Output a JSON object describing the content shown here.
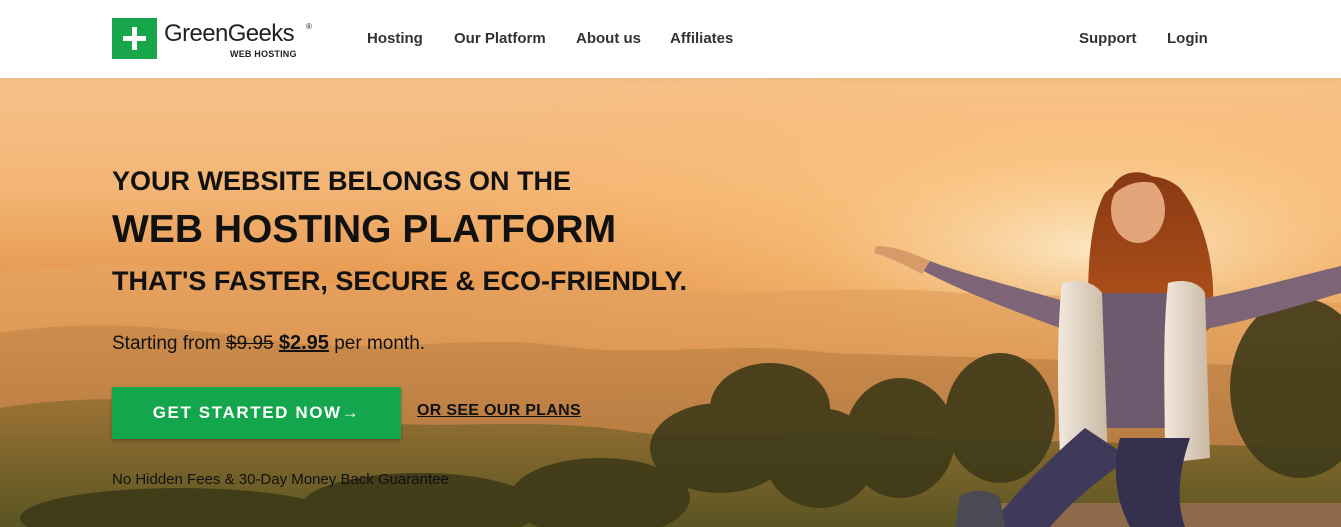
{
  "brand": {
    "name": "GreenGeeks",
    "registered_mark": "®",
    "tagline": "WEB HOSTING",
    "accent_color": "#17a74a"
  },
  "nav": {
    "left": [
      {
        "label": "Hosting"
      },
      {
        "label": "Our Platform"
      },
      {
        "label": "About us"
      },
      {
        "label": "Affiliates"
      }
    ],
    "right": [
      {
        "label": "Support"
      },
      {
        "label": "Login"
      }
    ]
  },
  "hero": {
    "line1": "YOUR WEBSITE BELONGS ON THE",
    "line2": "WEB HOSTING PLATFORM",
    "line3": "THAT'S FASTER, SECURE & ECO-FRIENDLY.",
    "price": {
      "prefix": "Starting from",
      "old_price": "$9.95",
      "new_price": "$2.95",
      "suffix": "per month."
    },
    "cta_label": "GET STARTED NOW",
    "cta_icon": "arrow-right-icon",
    "cta_color": "#13a64c",
    "plans_link": "OR SEE OUR PLANS",
    "guarantee": "No Hidden Fees & 30-Day Money Back Guarantee",
    "photo": "woman-sitting-arms-outstretched-sunset-hills"
  }
}
